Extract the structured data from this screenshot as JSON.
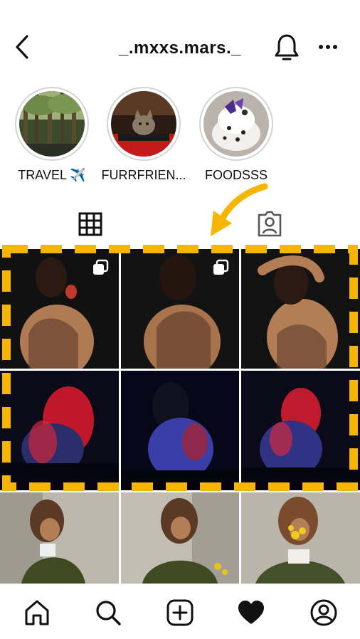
{
  "header": {
    "username": "_.mxxs.mars._",
    "back_icon": "chevron-left-icon",
    "bell_icon": "bell-icon",
    "more_icon": "more-horizontal-icon"
  },
  "highlights": [
    {
      "label": "TRAVEL ✈️"
    },
    {
      "label": "FURRFRIEN..."
    },
    {
      "label": "FOODSSS"
    }
  ],
  "tabs": {
    "grid_icon": "grid-icon",
    "tagged_icon": "tagged-icon"
  },
  "colors": {
    "annotation": "#f7b500",
    "text": "#111111"
  },
  "bottom_nav": {
    "items": [
      "home-icon",
      "search-icon",
      "add-post-icon",
      "activity-heart-icon",
      "profile-icon"
    ]
  }
}
